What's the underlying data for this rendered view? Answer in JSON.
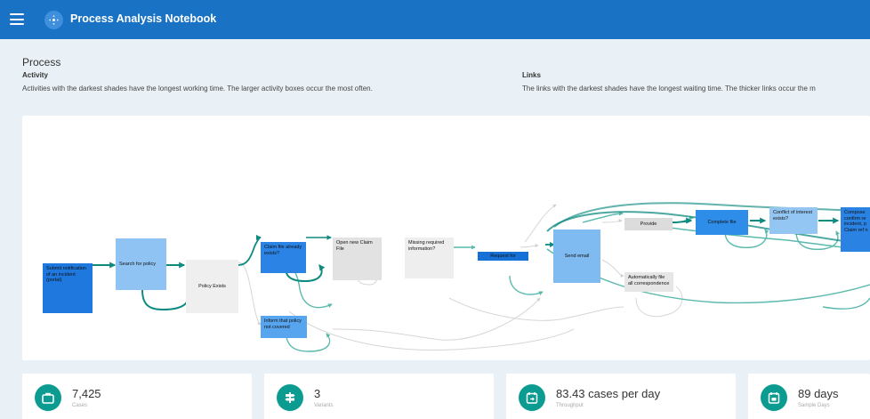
{
  "app": {
    "title": "Process Analysis Notebook"
  },
  "page": {
    "title": "Process",
    "activity": {
      "heading": "Activity",
      "text": "Activities with the darkest shades have the longest working time. The larger activity boxes occur the most often."
    },
    "links": {
      "heading": "Links",
      "text": "The links with the darkest shades have the longest waiting time. The thicker links occur the m"
    }
  },
  "nodes": [
    {
      "id": "submit",
      "label": "Submit notification of an incident (portal)",
      "color": "#1e78dd"
    },
    {
      "id": "search",
      "label": "Search for policy",
      "color": "#8fc3f3"
    },
    {
      "id": "policy_exists",
      "label": "Policy Exists",
      "color": "#efefef"
    },
    {
      "id": "claim_exists",
      "label": "Claim file already exists?",
      "color": "#2b83e6"
    },
    {
      "id": "inform",
      "label": "Inform that policy not covered",
      "color": "#57a5ef"
    },
    {
      "id": "open_new",
      "label": "Open new Claim File",
      "color": "#e2e2e2"
    },
    {
      "id": "missing",
      "label": "Missing required information?",
      "color": "#eeeeee"
    },
    {
      "id": "request",
      "label": "Request for",
      "color": "#1670d6"
    },
    {
      "id": "send_email",
      "label": "Send email",
      "color": "#7fbaf1"
    },
    {
      "id": "provide",
      "label": "Provide",
      "color": "#dcdcdc"
    },
    {
      "id": "auto_file",
      "label": "Automatically file all correspondence",
      "color": "#e6e6e6"
    },
    {
      "id": "complete",
      "label": "Complete file",
      "color": "#2e8de8"
    },
    {
      "id": "conflict",
      "label": "Conflict of interest exists?",
      "color": "#94c6f4"
    },
    {
      "id": "compose",
      "label": "Compose confirm re incident, p Claim ref n",
      "color": "#2a82e3"
    }
  ],
  "stats": [
    {
      "value": "7,425",
      "label": "Cases",
      "icon": "briefcase-icon"
    },
    {
      "value": "3",
      "label": "Variants",
      "icon": "signpost-icon"
    },
    {
      "value": "83.43 cases per day",
      "label": "Throughput",
      "icon": "calendar-arrow-icon"
    },
    {
      "value": "89 days",
      "label": "Sample Days",
      "icon": "calendar-icon"
    }
  ],
  "colors": {
    "header": "#1a72c5",
    "link": "#0e8b80",
    "link_light": "#5ab9ac",
    "link_faint": "#d4d4d4",
    "accent": "#0c9b91"
  }
}
